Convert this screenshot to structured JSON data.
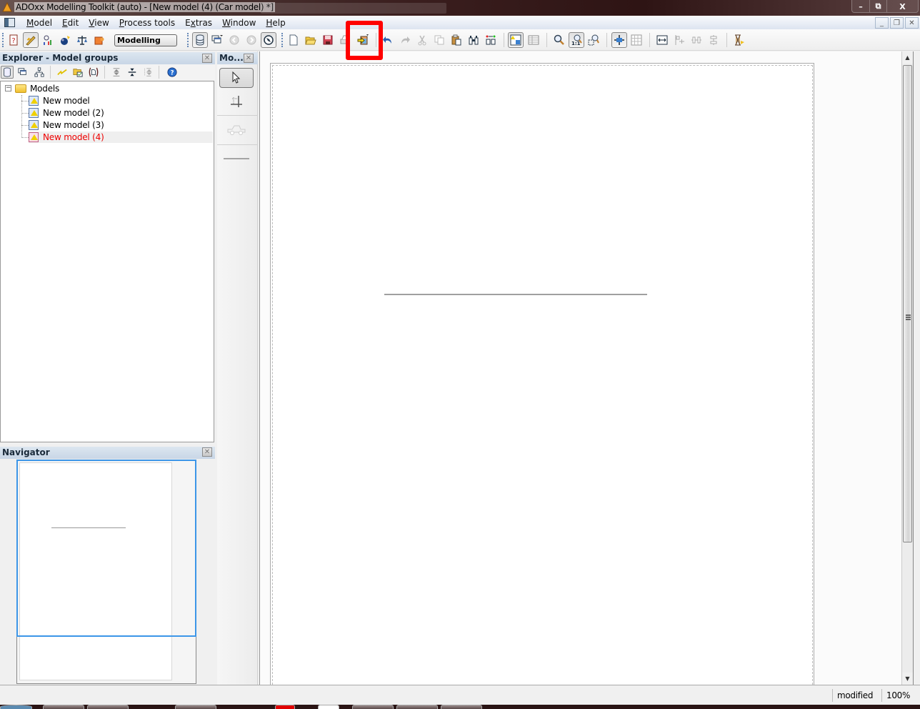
{
  "window": {
    "title": "ADOxx Modelling Toolkit (auto) - [New model (4) (Car model) *]",
    "controls": {
      "minimize": "–",
      "restore": "⧉",
      "close": "X"
    }
  },
  "menubar": {
    "items": [
      {
        "label": "Model",
        "mnemonic": "M"
      },
      {
        "label": "Edit",
        "mnemonic": "E"
      },
      {
        "label": "View",
        "mnemonic": "V"
      },
      {
        "label": "Process tools",
        "mnemonic": "P"
      },
      {
        "label": "Extras",
        "mnemonic": "x"
      },
      {
        "label": "Window",
        "mnemonic": "W"
      },
      {
        "label": "Help",
        "mnemonic": "H"
      }
    ],
    "mdi_controls": {
      "minimize": "_",
      "restore": "❐",
      "close": "✕"
    }
  },
  "toolbar": {
    "mode_select": "Modelling",
    "highlighted_button": "import-export-button",
    "highlight_color": "#ff0000",
    "icons": {
      "help": "?",
      "modelling": "✎",
      "analysis": "⚖",
      "simulation": "◕",
      "evaluation": "⚖",
      "import_export": "⇨",
      "model_list": "☰",
      "windows": "⧉",
      "back": "❮",
      "forward": "❯",
      "navigate": "⊕",
      "new": "☐",
      "open": "Ὄ2",
      "save": "▣",
      "print": "⎙",
      "undo": "↶",
      "redo": "↷",
      "cut": "✂",
      "copy": "⎘",
      "paste": "⎙",
      "find": "⚐",
      "compare": "⇆",
      "graphic_view": "▦",
      "table_view": "▤",
      "zoom": "⌕",
      "zoom_1_1": "1:1",
      "zoom_fit": "⤢",
      "grid_center": "✚",
      "grid": "▦",
      "align_h": "↔",
      "align_left": "⫪",
      "align_center_v": "⫫",
      "align_center_h": "⫬",
      "timer": "⧗"
    }
  },
  "explorer": {
    "title": "Explorer - Model groups",
    "close": "✕",
    "tree": {
      "root": {
        "label": "Models",
        "expanded": true,
        "toggle": "−"
      },
      "items": [
        {
          "label": "New model",
          "selected": false
        },
        {
          "label": "New model (2)",
          "selected": false
        },
        {
          "label": "New model (3)",
          "selected": false
        },
        {
          "label": "New model (4)",
          "selected": true
        }
      ]
    },
    "selected_color": "#ee0000"
  },
  "modelling_bar": {
    "title": "Mo...",
    "close": "✕",
    "tools": [
      {
        "name": "select",
        "pressed": true
      },
      {
        "name": "swimlane",
        "pressed": false
      },
      {
        "name": "car",
        "pressed": false
      },
      {
        "name": "edge",
        "pressed": false
      }
    ]
  },
  "navigator": {
    "title": "Navigator",
    "close": "✕",
    "viewport_color": "#3c96e8"
  },
  "statusbar": {
    "state": "modified",
    "zoom": "100%"
  }
}
